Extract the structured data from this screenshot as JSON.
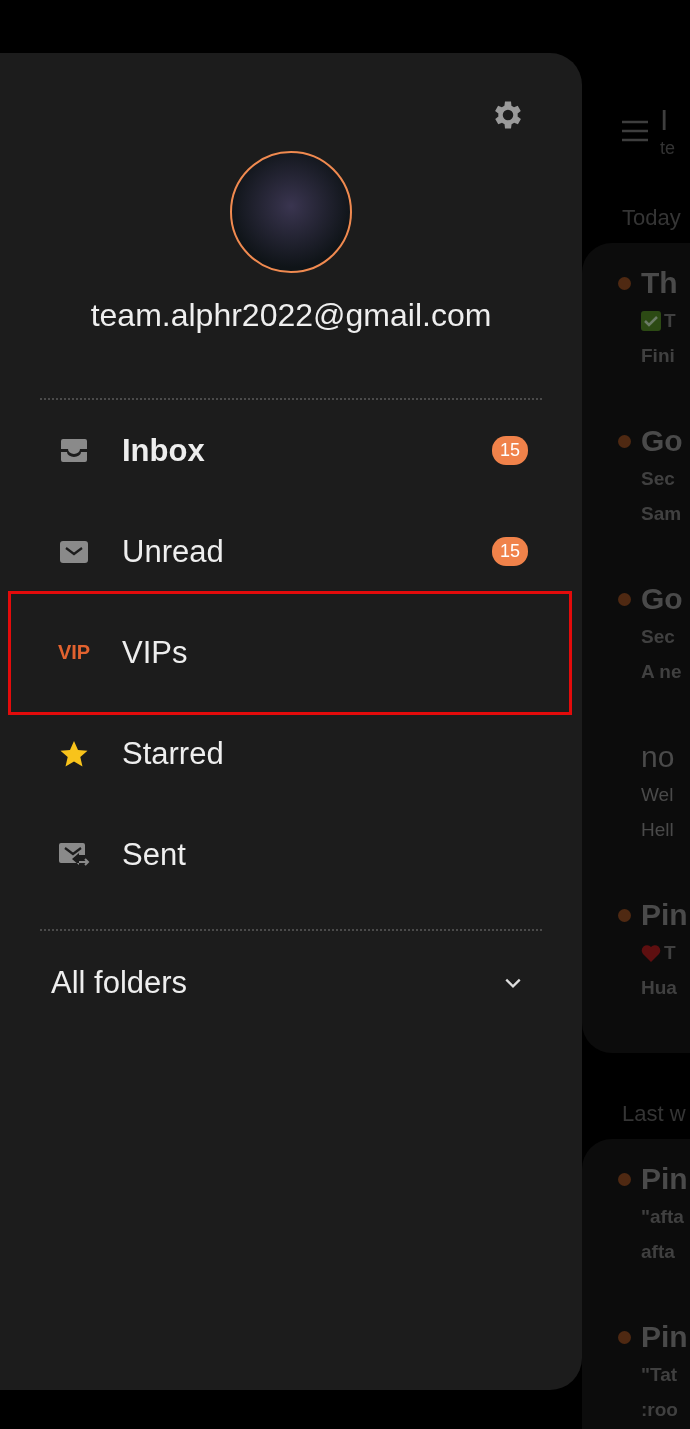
{
  "drawer": {
    "account_email": "team.alphr2022@gmail.com",
    "folders": [
      {
        "kind": "inbox",
        "label": "Inbox",
        "selected": true,
        "highlighted": false,
        "badge": "15"
      },
      {
        "kind": "mail",
        "label": "Unread",
        "selected": false,
        "highlighted": false,
        "badge": "15"
      },
      {
        "kind": "vip",
        "icon_text": "VIP",
        "label": "VIPs",
        "selected": false,
        "highlighted": true
      },
      {
        "kind": "star",
        "label": "Starred",
        "selected": false,
        "highlighted": false
      },
      {
        "kind": "sent",
        "label": "Sent",
        "selected": false,
        "highlighted": false
      }
    ],
    "all_folders": {
      "label": "All folders",
      "expanded": false
    }
  },
  "mail_list": {
    "title": "I",
    "subtitle": "te",
    "sections": [
      {
        "heading": "Today",
        "messages": [
          {
            "title": "Th",
            "unread": true,
            "lines": [
              {
                "kind": "check",
                "text": "T"
              },
              {
                "text": "Fini"
              }
            ]
          },
          {
            "title": "Go",
            "unread": true,
            "lines": [
              {
                "text": "Sec"
              },
              {
                "text": "Sam"
              }
            ]
          },
          {
            "title": "Go",
            "unread": true,
            "lines": [
              {
                "text": "Sec"
              },
              {
                "text": "A ne"
              }
            ]
          },
          {
            "title": "no",
            "unread": false,
            "lines": [
              {
                "text": "Wel"
              },
              {
                "text": "Hell"
              }
            ]
          },
          {
            "title": "Pin",
            "unread": true,
            "lines": [
              {
                "kind": "heart",
                "text": "T"
              },
              {
                "text": "Hua"
              }
            ]
          }
        ]
      },
      {
        "heading": "Last w",
        "messages": [
          {
            "title": "Pin",
            "unread": true,
            "lines": [
              {
                "text": "\"afta"
              },
              {
                "text": "afta"
              }
            ]
          },
          {
            "title": "Pin",
            "unread": true,
            "lines": [
              {
                "text": "\"Tat"
              },
              {
                "text": ":roo"
              }
            ]
          }
        ]
      }
    ]
  }
}
